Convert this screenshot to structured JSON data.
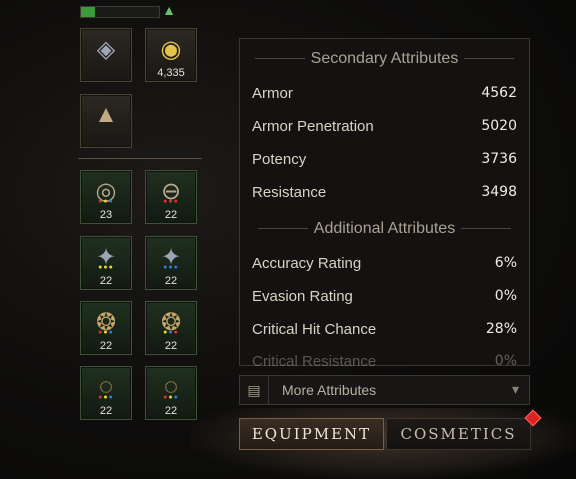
{
  "hud": {
    "progress_fraction": 0.18,
    "level_up_icon": "green-arrow-up-icon"
  },
  "slots": [
    {
      "name": "helm-slot",
      "icon": "diamond-crest-icon",
      "count": ""
    },
    {
      "name": "currency-slot",
      "icon": "gold-orb-icon",
      "count": "4,335"
    },
    {
      "name": "emblem-slot",
      "icon": "triangle-sigil-icon",
      "count": ""
    },
    {
      "name": "necklace-slot",
      "icon": "necklace-icon",
      "count": "23"
    },
    {
      "name": "belt-slot",
      "icon": "belt-icon",
      "count": "22"
    },
    {
      "name": "bracer-left-slot",
      "icon": "bracer-icon",
      "count": "22"
    },
    {
      "name": "bracer-right-slot",
      "icon": "bracer-icon",
      "count": "22"
    },
    {
      "name": "ring-1-slot",
      "icon": "ring-icon",
      "count": "22"
    },
    {
      "name": "ring-2-slot",
      "icon": "ring-icon",
      "count": "22"
    },
    {
      "name": "ring-3-slot",
      "icon": "ring-icon",
      "count": "22"
    },
    {
      "name": "ring-4-slot",
      "icon": "ring-icon",
      "count": "22"
    }
  ],
  "secondary": {
    "title": "Secondary Attributes",
    "rows": [
      {
        "label": "Armor",
        "value": "4562"
      },
      {
        "label": "Armor Penetration",
        "value": "5020"
      },
      {
        "label": "Potency",
        "value": "3736"
      },
      {
        "label": "Resistance",
        "value": "3498"
      }
    ]
  },
  "additional": {
    "title": "Additional Attributes",
    "rows": [
      {
        "label": "Accuracy Rating",
        "value": "6%"
      },
      {
        "label": "Evasion Rating",
        "value": "0%"
      },
      {
        "label": "Critical Hit Chance",
        "value": "28%"
      },
      {
        "label": "Critical Resistance",
        "value": "0%"
      }
    ]
  },
  "more": {
    "label": "More Attributes",
    "icon": "scroll-icon",
    "chevron": "▾"
  },
  "tabs": {
    "equipment": "EQUIPMENT",
    "cosmetics": "COSMETICS"
  },
  "colors": {
    "accent_green": "#3b9b3a",
    "notification_red": "#dd2222"
  }
}
